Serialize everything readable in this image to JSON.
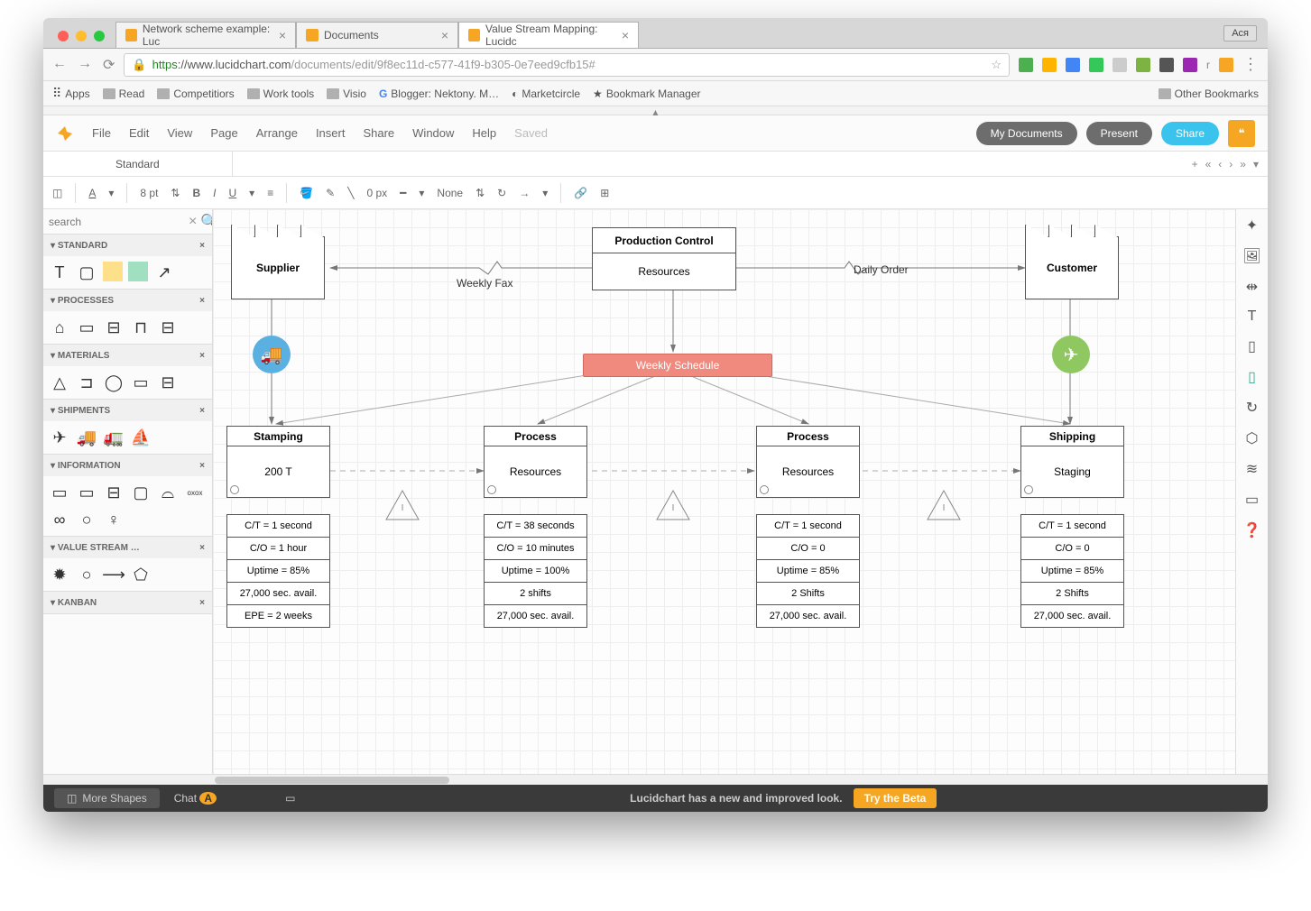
{
  "browser": {
    "tabs": [
      {
        "title": "Network scheme example: Luc"
      },
      {
        "title": "Documents"
      },
      {
        "title": "Value Stream Mapping: Lucidc"
      }
    ],
    "user_badge": "Ася",
    "url_prefix": "https",
    "url_host": "://www.lucidchart.com",
    "url_path": "/documents/edit/9f8ec11d-c577-41f9-b305-0e7eed9cfb15#",
    "bookmarks": [
      "Apps",
      "Read",
      "Competitiors",
      "Work tools",
      "Visio",
      "Blogger: Nektony. M…",
      "Marketcircle",
      "Bookmark Manager"
    ],
    "other_bookmarks": "Other Bookmarks"
  },
  "menubar": {
    "items": [
      "File",
      "Edit",
      "View",
      "Page",
      "Arrange",
      "Insert",
      "Share",
      "Window",
      "Help"
    ],
    "status": "Saved",
    "my_docs": "My Documents",
    "present": "Present",
    "share": "Share"
  },
  "doc_tab": "Standard",
  "toolbar": {
    "font_size": "8 pt",
    "line_width": "0 px",
    "line_style": "None"
  },
  "shape_panel": {
    "search_placeholder": "search",
    "sections": [
      "STANDARD",
      "PROCESSES",
      "MATERIALS",
      "SHIPMENTS",
      "INFORMATION",
      "VALUE STREAM …",
      "KANBAN"
    ]
  },
  "diagram": {
    "supplier": "Supplier",
    "customer": "Customer",
    "prod_control_top": "Production Control",
    "prod_control_bot": "Resources",
    "weekly_fax": "Weekly Fax",
    "daily_order": "Daily Order",
    "schedule": "Weekly Schedule",
    "processes": [
      {
        "top": "Stamping",
        "bot": "200 T"
      },
      {
        "top": "Process",
        "bot": "Resources"
      },
      {
        "top": "Process",
        "bot": "Resources"
      },
      {
        "top": "Shipping",
        "bot": "Staging"
      }
    ],
    "databoxes": [
      [
        "C/T = 1 second",
        "C/O = 1 hour",
        "Uptime = 85%",
        "27,000 sec. avail.",
        "EPE = 2 weeks"
      ],
      [
        "C/T = 38 seconds",
        "C/O = 10 minutes",
        "Uptime = 100%",
        "2 shifts",
        "27,000 sec. avail."
      ],
      [
        "C/T = 1 second",
        "C/O = 0",
        "Uptime = 85%",
        "2 Shifts",
        "27,000 sec. avail."
      ],
      [
        "C/T = 1 second",
        "C/O = 0",
        "Uptime = 85%",
        "2 Shifts",
        "27,000 sec. avail."
      ]
    ]
  },
  "status": {
    "more_shapes": "More Shapes",
    "chat": "Chat",
    "banner": "Lucidchart has a new and improved look.",
    "cta": "Try the Beta"
  }
}
